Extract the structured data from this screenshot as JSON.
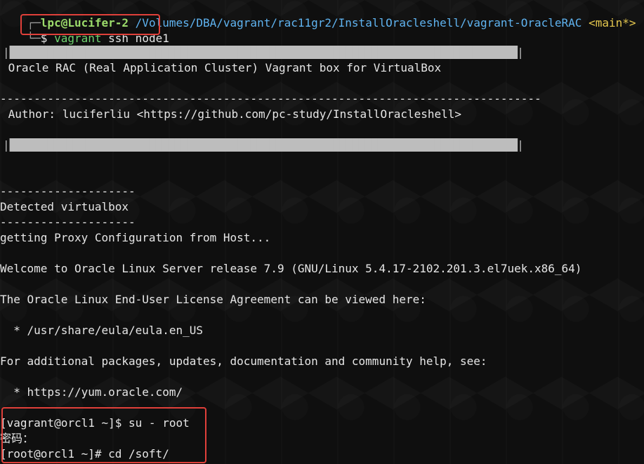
{
  "prompt": {
    "user_host": "lpc@Lucifer-2",
    "path": "/Volumes/DBA/vagrant/rac11gr2/InstallOracleshell/vagrant-OracleRAC",
    "branch": "<main*>",
    "dollar": "$",
    "command_program": "vagrant",
    "command_args": " ssh node1"
  },
  "banner": {
    "hash_row": "████████████████████████████████████████████████████████████████████████████████",
    "title": " Oracle RAC (Real Application Cluster) Vagrant box for VirtualBox",
    "dash_row": "--------------------------------------------------------------------------------",
    "author": " Author: luciferliu <https://github.com/pc-study/InstallOracleshell>"
  },
  "output": {
    "sep_short": "--------------------",
    "detected": "Detected virtualbox",
    "proxy": "getting Proxy Configuration from Host...",
    "welcome": "Welcome to Oracle Linux Server release 7.9 (GNU/Linux 5.4.17-2102.201.3.el7uek.x86_64)",
    "eula_intro": "The Oracle Linux End-User License Agreement can be viewed here:",
    "eula_path": "  * /usr/share/eula/eula.en_US",
    "additional": "For additional packages, updates, documentation and community help, see:",
    "yum_url": "  * https://yum.oracle.com/"
  },
  "session": {
    "su_line": "[vagrant@orcl1 ~]$ su - root",
    "password_prompt": "密码：",
    "cd_line": "[root@orcl1 ~]# cd /soft/"
  },
  "colors": {
    "highlight_border": "#e0403a",
    "prompt_user": "#9cdc6b",
    "prompt_path": "#5fb3f0",
    "prompt_branch": "#e6c84e",
    "command": "#6fd36f"
  }
}
